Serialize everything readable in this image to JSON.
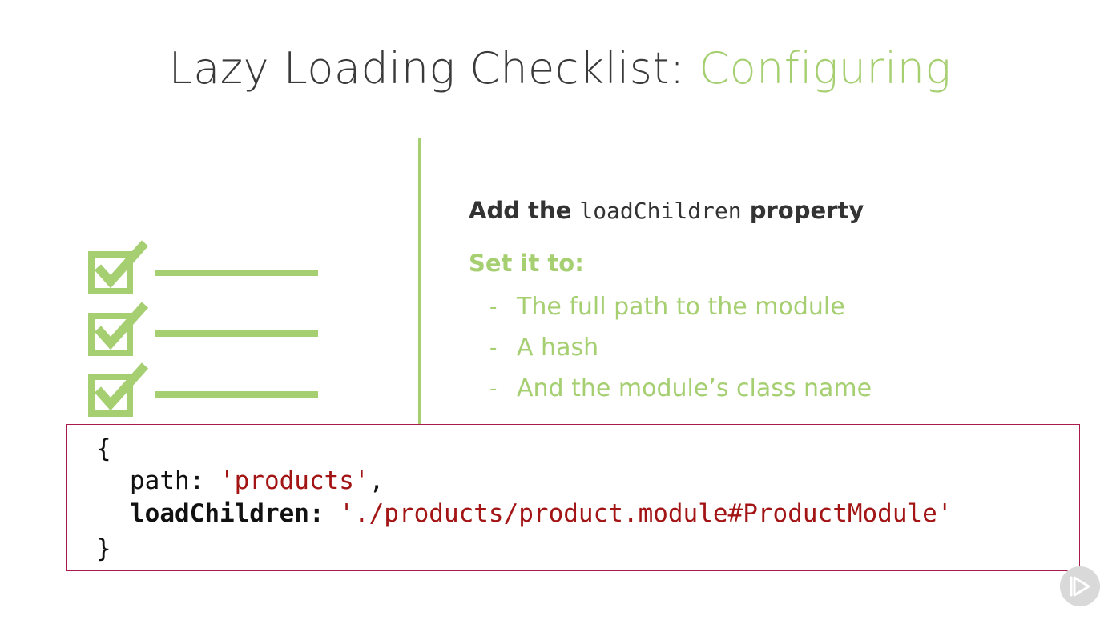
{
  "slide": {
    "title_main": "Lazy Loading Checklist: ",
    "title_accent": "Configuring"
  },
  "content": {
    "heading_prefix": "Add the ",
    "heading_code": "loadChildren",
    "heading_suffix": " property",
    "subheading": "Set it to:",
    "bullets": [
      {
        "dash": "-",
        "text": "The full path to the module"
      },
      {
        "dash": "-",
        "text": "A hash"
      },
      {
        "dash": "-",
        "text": "And the module’s class name"
      }
    ]
  },
  "code": {
    "open_brace": "{",
    "path_key": "path: ",
    "path_value": "'products'",
    "path_comma": ",",
    "loadchildren_key": "loadChildren: ",
    "loadchildren_value": "'./products/product.module#ProductModule'",
    "close_brace": "}"
  },
  "icons": {
    "checklist": "checklist-icon",
    "play": "play-icon"
  },
  "colors": {
    "accent_green": "#a6cf72",
    "title_gray": "#3a3a3a",
    "code_string": "#a31515",
    "code_border": "#a81b4c"
  }
}
